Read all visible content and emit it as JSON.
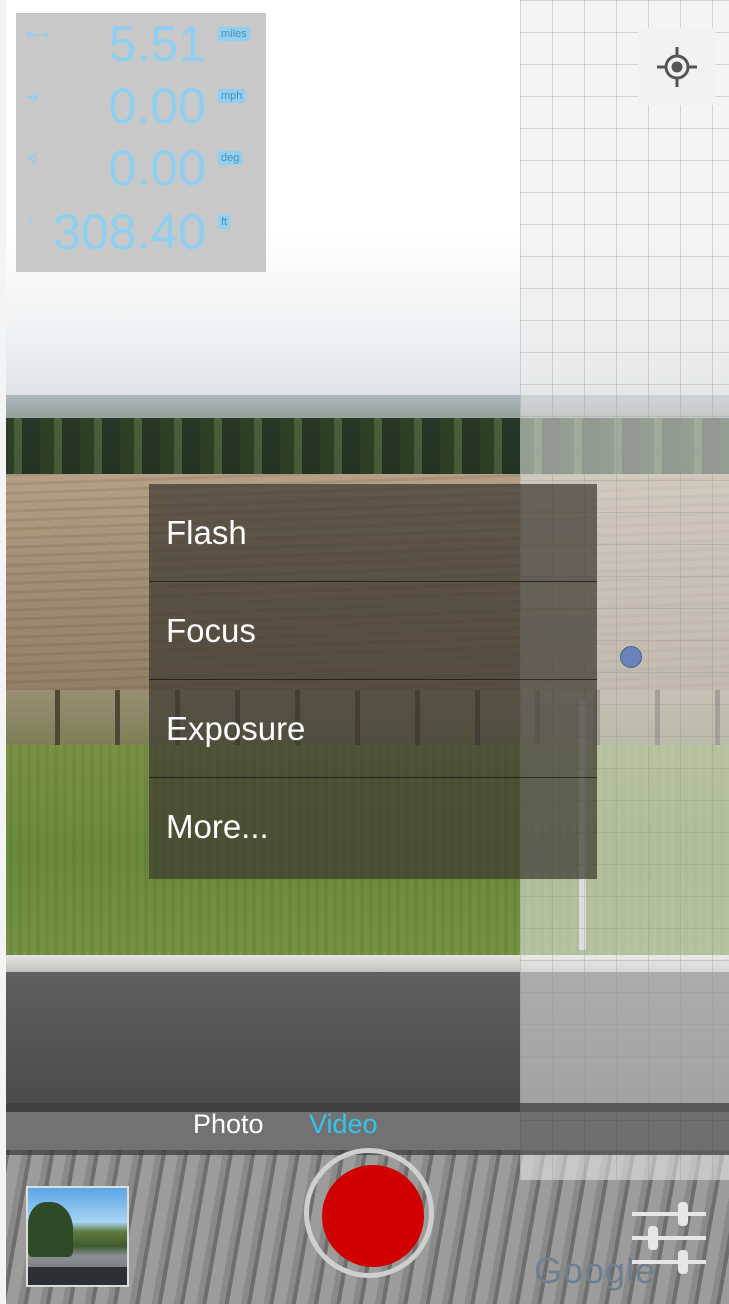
{
  "hud": {
    "rows": [
      {
        "icon": "distance-icon",
        "value": "5.51",
        "unit": "miles"
      },
      {
        "icon": "speed-icon",
        "value": "0.00",
        "unit": "mph"
      },
      {
        "icon": "heading-icon",
        "value": "0.00",
        "unit": "deg"
      },
      {
        "icon": "altitude-icon",
        "value": "308.40",
        "unit": "ft"
      }
    ]
  },
  "menu": {
    "items": [
      "Flash",
      "Focus",
      "Exposure",
      "More..."
    ]
  },
  "modes": {
    "photo": "Photo",
    "video": "Video",
    "active": "Video"
  },
  "map": {
    "attribution": "Google"
  },
  "colors": {
    "hud_text": "#8fd0f2",
    "active_mode": "#33c4ee",
    "record": "#d00000"
  }
}
